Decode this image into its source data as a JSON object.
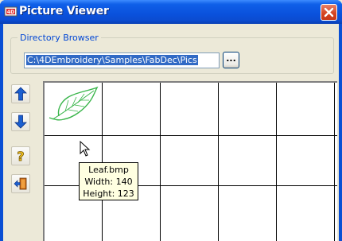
{
  "window": {
    "title": "Picture Viewer"
  },
  "directory": {
    "group_label": "Directory Browser",
    "path": "C:\\4DEmbroidery\\Samples\\FabDec\\Pics",
    "browse_label": "..."
  },
  "sidebar": {
    "buttons": [
      {
        "name": "scroll-up",
        "icon": "arrow-up-icon"
      },
      {
        "name": "scroll-down",
        "icon": "arrow-down-icon"
      },
      {
        "name": "help",
        "icon": "question-icon"
      },
      {
        "name": "exit",
        "icon": "exit-door-icon"
      }
    ]
  },
  "thumbnails": {
    "rows": 3,
    "cols": 5,
    "items": [
      {
        "file": "Leaf.bmp",
        "icon": "leaf-icon"
      }
    ]
  },
  "tooltip": {
    "filename": "Leaf.bmp",
    "width_line": "Width: 140",
    "height_line": "Height: 123"
  },
  "colors": {
    "titlebar": "#0a51dc",
    "leaf": "#39b54a",
    "tooltip_bg": "#ffffe1",
    "selection": "#316ac5"
  }
}
